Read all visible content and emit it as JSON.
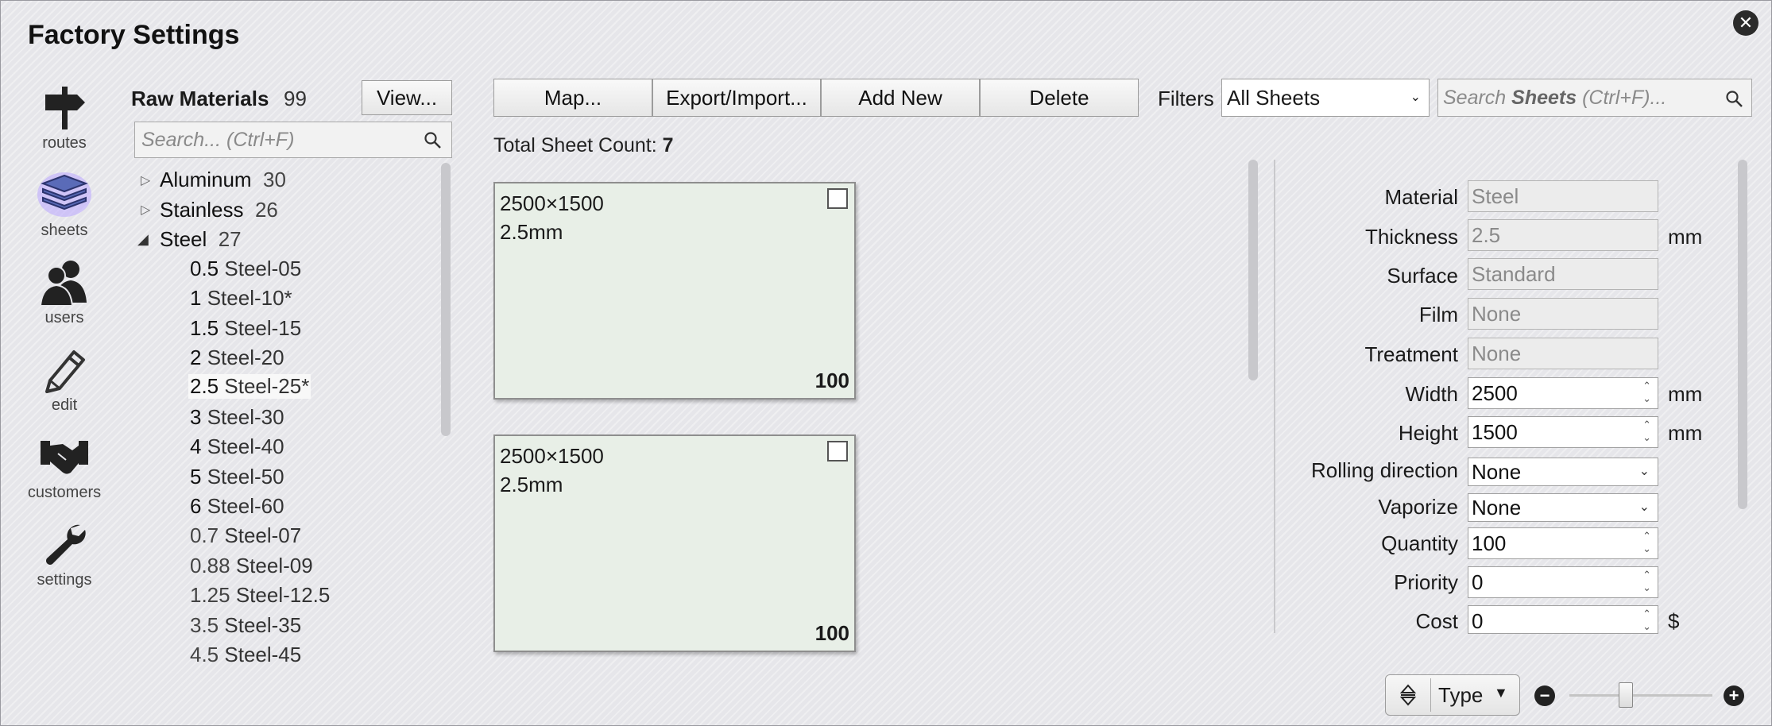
{
  "window": {
    "title": "Factory Settings"
  },
  "nav": [
    {
      "label": "routes",
      "icon": "signpost-icon"
    },
    {
      "label": "sheets",
      "icon": "sheets-stack-icon",
      "active": true
    },
    {
      "label": "users",
      "icon": "users-icon"
    },
    {
      "label": "edit",
      "icon": "pencil-icon"
    },
    {
      "label": "customers",
      "icon": "handshake-icon"
    },
    {
      "label": "settings",
      "icon": "wrench-icon"
    }
  ],
  "materials": {
    "title": "Raw Materials",
    "count": "99",
    "view_button": "View...",
    "search_placeholder": "Search... (Ctrl+F)",
    "groups": [
      {
        "name": "Aluminum",
        "count": "30",
        "expanded": false
      },
      {
        "name": "Stainless",
        "count": "26",
        "expanded": false
      },
      {
        "name": "Steel",
        "count": "27",
        "expanded": true
      }
    ],
    "steel_items": [
      {
        "num": "0.5",
        "name": "Steel-05"
      },
      {
        "num": "1",
        "name": "Steel-10*"
      },
      {
        "num": "1.5",
        "name": "Steel-15"
      },
      {
        "num": "2",
        "name": "Steel-20"
      },
      {
        "num": "2.5",
        "name": "Steel-25*",
        "selected": true
      },
      {
        "num": "3",
        "name": "Steel-30"
      },
      {
        "num": "4",
        "name": "Steel-40"
      },
      {
        "num": "5",
        "name": "Steel-50"
      },
      {
        "num": "6",
        "name": "Steel-60"
      },
      {
        "num": "0.7",
        "name": "Steel-07"
      },
      {
        "num": "0.88",
        "name": "Steel-09"
      },
      {
        "num": "1.25",
        "name": "Steel-12.5"
      },
      {
        "num": "3.5",
        "name": "Steel-35"
      },
      {
        "num": "4.5",
        "name": "Steel-45"
      }
    ]
  },
  "toolbar": {
    "map": "Map...",
    "export_import": "Export/Import...",
    "add_new": "Add New",
    "delete": "Delete",
    "filters_label": "Filters",
    "filter_value": "All Sheets",
    "search_prefix": "Search ",
    "search_bold": "Sheets",
    "search_suffix": " (Ctrl+F)..."
  },
  "sheets": {
    "count_label": "Total Sheet Count: ",
    "count": "7",
    "cards": [
      {
        "size": "2500×1500",
        "thickness": "2.5mm",
        "qty": "100"
      },
      {
        "size": "2500×1500",
        "thickness": "2.5mm",
        "qty": "100"
      }
    ]
  },
  "properties": {
    "material": {
      "label": "Material",
      "value": "Steel"
    },
    "thickness": {
      "label": "Thickness",
      "value": "2.5",
      "unit": "mm"
    },
    "surface": {
      "label": "Surface",
      "value": "Standard"
    },
    "film": {
      "label": "Film",
      "value": "None"
    },
    "treatment": {
      "label": "Treatment",
      "value": "None"
    },
    "width": {
      "label": "Width",
      "value": "2500",
      "unit": "mm"
    },
    "height": {
      "label": "Height",
      "value": "1500",
      "unit": "mm"
    },
    "rolling": {
      "label": "Rolling direction",
      "value": "None"
    },
    "vaporize": {
      "label": "Vaporize",
      "value": "None"
    },
    "quantity": {
      "label": "Quantity",
      "value": "100"
    },
    "priority": {
      "label": "Priority",
      "value": "0"
    },
    "cost": {
      "label": "Cost",
      "value": "0",
      "unit": "$"
    }
  },
  "footer": {
    "sort_label": "Type"
  }
}
